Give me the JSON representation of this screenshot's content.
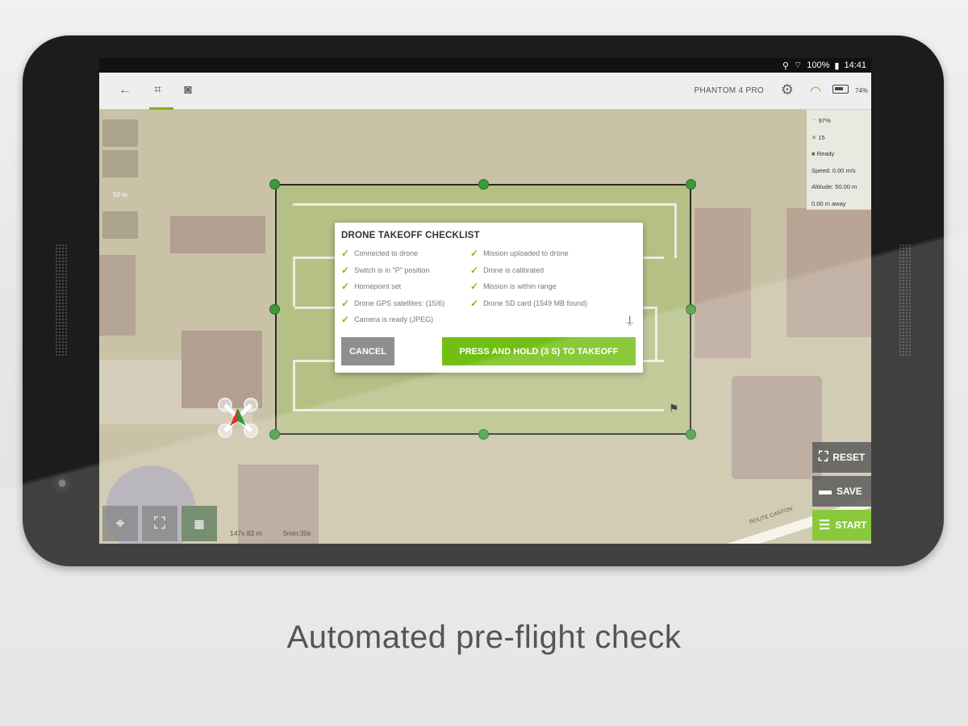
{
  "statusbar": {
    "battery": "100%",
    "time": "14:41"
  },
  "appbar": {
    "drone_name": "PHANTOM 4 PRO",
    "battery_pct": "74%"
  },
  "telemetry": {
    "signal": "97%",
    "satellites": "15",
    "status": "Ready",
    "speed": "Speed: 0.00 m/s",
    "altitude": "Altitude: 50.00 m",
    "distance": "0.00 m away"
  },
  "scale": {
    "label": "50 m"
  },
  "dialog": {
    "title": "DRONE TAKEOFF CHECKLIST",
    "checks_left": [
      "Connected to drone",
      "Switch is in \"P\" position",
      "Homepoint set",
      "Drone GPS satellites: (15/6)",
      "Camera is ready (JPEG)"
    ],
    "checks_right": [
      "Mission uploaded to drone",
      "Drone is calibrated",
      "Mission is within range",
      "Drone SD card (1549 MB found)"
    ],
    "cancel_label": "CANCEL",
    "takeoff_label": "PRESS AND HOLD (3 S) TO TAKEOFF"
  },
  "actions": {
    "reset": "RESET",
    "save": "SAVE",
    "start": "START"
  },
  "map_info": {
    "dimensions": "147x 82 m",
    "duration": "5min:30s",
    "street": "ROUTE CANTON"
  },
  "colors": {
    "accent": "#72bf14",
    "mission_handle": "#3d9a3a"
  },
  "tagline": "Automated pre-flight check"
}
